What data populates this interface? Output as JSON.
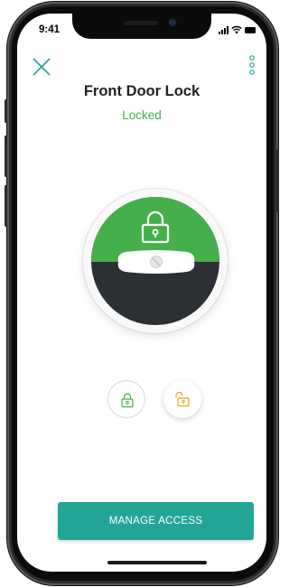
{
  "status_bar": {
    "time": "9:41"
  },
  "header": {
    "close_icon": "close-x-icon",
    "more_icon": "more-vertical-icon",
    "title": "Front Door Lock",
    "status": "Locked"
  },
  "lock_visual": {
    "state": "locked",
    "icon": "padlock-locked-icon"
  },
  "actions": {
    "lock_icon": "padlock-locked-icon",
    "unlock_icon": "padlock-unlocked-icon"
  },
  "footer": {
    "manage_label": "MANAGE ACCESS"
  },
  "colors": {
    "accent": "#22a596",
    "locked_green": "#45b04b",
    "status_text": "#3fae49",
    "unlock_orange": "#f0a020",
    "dark": "#2c2f33"
  }
}
